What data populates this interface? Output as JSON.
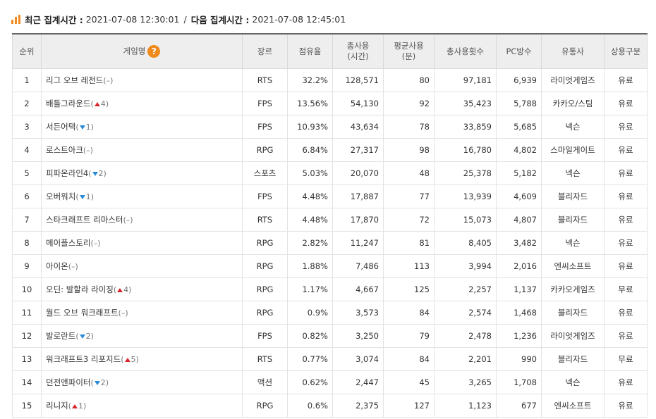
{
  "header": {
    "recent_label": "최근 집계시간 :",
    "recent_value": "2021-07-08 12:30:01",
    "separator": "/",
    "next_label": "다음 집계시간 :",
    "next_value": "2021-07-08 12:45:01",
    "icon": "bar-chart-icon",
    "accent": "#f08a1d"
  },
  "columns": {
    "rank": "순위",
    "game": "게임명",
    "help": "?",
    "genre": "장르",
    "share": "점유율",
    "total_hours_1": "총사용",
    "total_hours_2": "(시간)",
    "avg_1": "평균사용",
    "avg_2": "(분)",
    "count": "총사용횟수",
    "pc": "PC방수",
    "publisher": "유통사",
    "type": "상용구분"
  },
  "rows": [
    {
      "rank": "1",
      "name": "리그 오브 레전드",
      "change_dir": "none",
      "change": "–",
      "genre": "RTS",
      "share": "32.2%",
      "hours": "128,571",
      "avg": "80",
      "count": "97,181",
      "pc": "6,939",
      "publisher": "라이엇게임즈",
      "type": "유료"
    },
    {
      "rank": "2",
      "name": "배틀그라운드",
      "change_dir": "up",
      "change": "4",
      "genre": "FPS",
      "share": "13.56%",
      "hours": "54,130",
      "avg": "92",
      "count": "35,423",
      "pc": "5,788",
      "publisher": "카카오/스팀",
      "type": "유료"
    },
    {
      "rank": "3",
      "name": "서든어택",
      "change_dir": "down",
      "change": "1",
      "genre": "FPS",
      "share": "10.93%",
      "hours": "43,634",
      "avg": "78",
      "count": "33,859",
      "pc": "5,685",
      "publisher": "넥슨",
      "type": "유료"
    },
    {
      "rank": "4",
      "name": "로스트아크",
      "change_dir": "none",
      "change": "–",
      "genre": "RPG",
      "share": "6.84%",
      "hours": "27,317",
      "avg": "98",
      "count": "16,780",
      "pc": "4,802",
      "publisher": "스마일게이트",
      "type": "유료"
    },
    {
      "rank": "5",
      "name": "피파온라인4",
      "change_dir": "down",
      "change": "2",
      "genre": "스포츠",
      "share": "5.03%",
      "hours": "20,070",
      "avg": "48",
      "count": "25,378",
      "pc": "5,182",
      "publisher": "넥슨",
      "type": "유료"
    },
    {
      "rank": "6",
      "name": "오버워치",
      "change_dir": "down",
      "change": "1",
      "genre": "FPS",
      "share": "4.48%",
      "hours": "17,887",
      "avg": "77",
      "count": "13,939",
      "pc": "4,609",
      "publisher": "블리자드",
      "type": "유료"
    },
    {
      "rank": "7",
      "name": "스타크래프트 리마스터",
      "change_dir": "none",
      "change": "–",
      "genre": "RTS",
      "share": "4.48%",
      "hours": "17,870",
      "avg": "72",
      "count": "15,073",
      "pc": "4,807",
      "publisher": "블리자드",
      "type": "유료"
    },
    {
      "rank": "8",
      "name": "메이플스토리",
      "change_dir": "none",
      "change": "–",
      "genre": "RPG",
      "share": "2.82%",
      "hours": "11,247",
      "avg": "81",
      "count": "8,405",
      "pc": "3,482",
      "publisher": "넥슨",
      "type": "유료"
    },
    {
      "rank": "9",
      "name": "아이온",
      "change_dir": "none",
      "change": "–",
      "genre": "RPG",
      "share": "1.88%",
      "hours": "7,486",
      "avg": "113",
      "count": "3,994",
      "pc": "2,016",
      "publisher": "엔씨소프트",
      "type": "유료"
    },
    {
      "rank": "10",
      "name": "오딘: 발할라 라이징",
      "change_dir": "up",
      "change": "4",
      "genre": "RPG",
      "share": "1.17%",
      "hours": "4,667",
      "avg": "125",
      "count": "2,257",
      "pc": "1,137",
      "publisher": "카카오게임즈",
      "type": "무료"
    },
    {
      "rank": "11",
      "name": "월드 오브 워크래프트",
      "change_dir": "none",
      "change": "–",
      "genre": "RPG",
      "share": "0.9%",
      "hours": "3,573",
      "avg": "84",
      "count": "2,574",
      "pc": "1,468",
      "publisher": "블리자드",
      "type": "유료"
    },
    {
      "rank": "12",
      "name": "발로란트",
      "change_dir": "down",
      "change": "2",
      "genre": "FPS",
      "share": "0.82%",
      "hours": "3,250",
      "avg": "79",
      "count": "2,478",
      "pc": "1,236",
      "publisher": "라이엇게임즈",
      "type": "유료"
    },
    {
      "rank": "13",
      "name": "워크래프트3 리포지드",
      "change_dir": "up",
      "change": "5",
      "genre": "RTS",
      "share": "0.77%",
      "hours": "3,074",
      "avg": "84",
      "count": "2,201",
      "pc": "990",
      "publisher": "블리자드",
      "type": "무료"
    },
    {
      "rank": "14",
      "name": "던전앤파이터",
      "change_dir": "down",
      "change": "2",
      "genre": "액션",
      "share": "0.62%",
      "hours": "2,447",
      "avg": "45",
      "count": "3,265",
      "pc": "1,708",
      "publisher": "넥슨",
      "type": "유료"
    },
    {
      "rank": "15",
      "name": "리니지",
      "change_dir": "up",
      "change": "1",
      "genre": "RPG",
      "share": "0.6%",
      "hours": "2,375",
      "avg": "127",
      "count": "1,123",
      "pc": "677",
      "publisher": "엔씨소프트",
      "type": "유료"
    }
  ]
}
